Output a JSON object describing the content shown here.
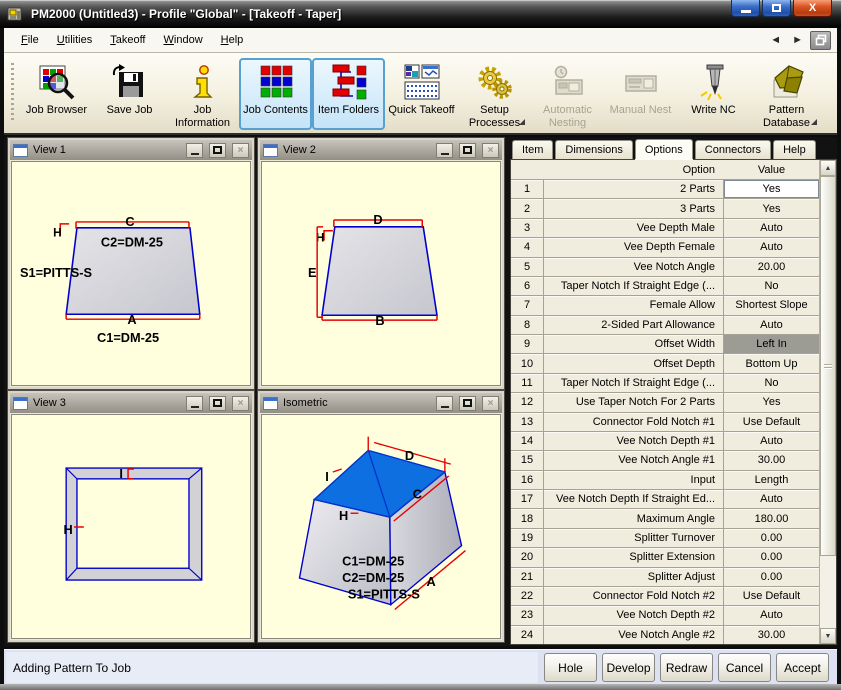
{
  "window": {
    "title": "PM2000 (Untitled3) - Profile \"Global\" - [Takeoff - Taper]"
  },
  "icons": {
    "minimize": "minimize",
    "maximize": "maximize",
    "close": "X",
    "close_small": "×",
    "back": "◄",
    "forward": "►",
    "up": "▲",
    "down": "▼"
  },
  "menubar": {
    "items": [
      "File",
      "Utilities",
      "Takeoff",
      "Window",
      "Help"
    ]
  },
  "toolbar": {
    "buttons": [
      {
        "label": "Job Browser",
        "icon": "job-browser-icon",
        "state": "normal"
      },
      {
        "label": "Save Job",
        "icon": "save-job-icon",
        "state": "normal"
      },
      {
        "label": "Job Information",
        "icon": "job-information-icon",
        "state": "normal"
      },
      {
        "label": "Job Contents",
        "icon": "job-contents-icon",
        "state": "active"
      },
      {
        "label": "Item Folders",
        "icon": "item-folders-icon",
        "state": "active"
      },
      {
        "label": "Quick Takeoff",
        "icon": "quick-takeoff-icon",
        "state": "normal"
      },
      {
        "label": "Setup Processes",
        "icon": "setup-processes-icon",
        "state": "normal",
        "dropdown": true
      },
      {
        "label": "Automatic Nesting",
        "icon": "automatic-nesting-icon",
        "state": "disabled"
      },
      {
        "label": "Manual Nest",
        "icon": "manual-nest-icon",
        "state": "disabled"
      },
      {
        "label": "Write NC",
        "icon": "write-nc-icon",
        "state": "normal"
      },
      {
        "label": "Pattern Database",
        "icon": "pattern-database-icon",
        "state": "normal",
        "dropdown": true
      }
    ]
  },
  "views": {
    "view1": {
      "title": "View 1",
      "labels": {
        "c": "C",
        "h": "H",
        "c2": "C2=DM-25",
        "s1": "S1=PITTS-S",
        "a": "A",
        "c1": "C1=DM-25"
      }
    },
    "view2": {
      "title": "View 2",
      "labels": {
        "d": "D",
        "h": "H",
        "e": "E",
        "b": "B"
      }
    },
    "view3": {
      "title": "View 3",
      "labels": {
        "i": "I",
        "h": "H"
      }
    },
    "iso": {
      "title": "Isometric",
      "labels": {
        "d": "D",
        "i": "I",
        "c": "C",
        "h": "H",
        "a": "A",
        "c1": "C1=DM-25",
        "c2": "C2=DM-25",
        "s1": "S1=PITTS-S"
      }
    }
  },
  "panel": {
    "tabs": [
      {
        "label": "Item"
      },
      {
        "label": "Dimensions"
      },
      {
        "label": "Options",
        "active": true
      },
      {
        "label": "Connectors"
      },
      {
        "label": "Help"
      }
    ],
    "table": {
      "headers": {
        "option": "Option",
        "value": "Value"
      },
      "rows": [
        {
          "num": 1,
          "option": "2 Parts",
          "value": "Yes",
          "state": "edit"
        },
        {
          "num": 2,
          "option": "3 Parts",
          "value": "Yes"
        },
        {
          "num": 3,
          "option": "Vee Depth Male",
          "value": "Auto"
        },
        {
          "num": 4,
          "option": "Vee Depth Female",
          "value": "Auto"
        },
        {
          "num": 5,
          "option": "Vee Notch Angle",
          "value": "20.00"
        },
        {
          "num": 6,
          "option": "Taper Notch If Straight Edge (...",
          "value": "No"
        },
        {
          "num": 7,
          "option": "Female Allow",
          "value": "Shortest Slope"
        },
        {
          "num": 8,
          "option": "2-Sided Part Allowance",
          "value": "Auto"
        },
        {
          "num": 9,
          "option": "Offset Width",
          "value": "Left In",
          "state": "selected"
        },
        {
          "num": 10,
          "option": "Offset Depth",
          "value": "Bottom Up"
        },
        {
          "num": 11,
          "option": "Taper Notch If Straight Edge (...",
          "value": "No"
        },
        {
          "num": 12,
          "option": "Use Taper Notch For 2 Parts",
          "value": "Yes"
        },
        {
          "num": 13,
          "option": "Connector Fold Notch #1",
          "value": "Use Default"
        },
        {
          "num": 14,
          "option": "Vee Notch Depth #1",
          "value": "Auto"
        },
        {
          "num": 15,
          "option": "Vee Notch Angle #1",
          "value": "30.00"
        },
        {
          "num": 16,
          "option": "Input",
          "value": "Length"
        },
        {
          "num": 17,
          "option": "Vee Notch Depth If Straight Ed...",
          "value": "Auto"
        },
        {
          "num": 18,
          "option": "Maximum Angle",
          "value": "180.00"
        },
        {
          "num": 19,
          "option": "Splitter Turnover",
          "value": "0.00"
        },
        {
          "num": 20,
          "option": "Splitter Extension",
          "value": "0.00"
        },
        {
          "num": 21,
          "option": "Splitter Adjust",
          "value": "0.00"
        },
        {
          "num": 22,
          "option": "Connector Fold Notch #2",
          "value": "Use Default"
        },
        {
          "num": 23,
          "option": "Vee Notch Depth #2",
          "value": "Auto"
        },
        {
          "num": 24,
          "option": "Vee Notch Angle #2",
          "value": "30.00"
        }
      ]
    }
  },
  "statusbar": {
    "message": "Adding Pattern To Job",
    "buttons": [
      "Hole",
      "Develop",
      "Redraw",
      "Cancel",
      "Accept"
    ]
  },
  "colors": {
    "view_background": "#FFFFDE",
    "outline_blue": "#0000CD",
    "dimension_red": "#E80000",
    "top_face_blue": "#0E6FE0",
    "selected_cell": "#9C9C94",
    "active_button_border": "#58A0CF",
    "active_button_fill": "#C5E4F8",
    "table_background": "#F0EDDE"
  }
}
